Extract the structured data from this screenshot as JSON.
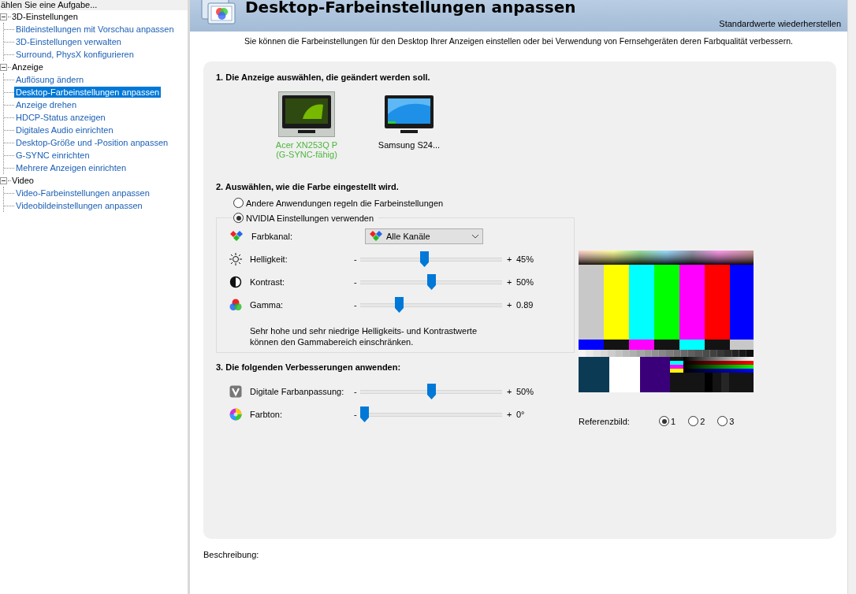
{
  "sidebar": {
    "header": "ählen Sie eine Aufgabe...",
    "tree": [
      {
        "label": "3D-Einstellungen",
        "expanded": true,
        "children": [
          {
            "label": "Bildeinstellungen mit Vorschau anpassen",
            "selected": false
          },
          {
            "label": "3D-Einstellungen verwalten",
            "selected": false
          },
          {
            "label": "Surround, PhysX konfigurieren",
            "selected": false
          }
        ]
      },
      {
        "label": "Anzeige",
        "expanded": true,
        "children": [
          {
            "label": "Auflösung ändern",
            "selected": false
          },
          {
            "label": "Desktop-Farbeinstellungen anpassen",
            "selected": true
          },
          {
            "label": "Anzeige drehen",
            "selected": false
          },
          {
            "label": "HDCP-Status anzeigen",
            "selected": false
          },
          {
            "label": "Digitales Audio einrichten",
            "selected": false
          },
          {
            "label": "Desktop-Größe und -Position anpassen",
            "selected": false
          },
          {
            "label": "G-SYNC einrichten",
            "selected": false
          },
          {
            "label": "Mehrere Anzeigen einrichten",
            "selected": false
          }
        ]
      },
      {
        "label": "Video",
        "expanded": true,
        "children": [
          {
            "label": "Video-Farbeinstellungen anpassen",
            "selected": false
          },
          {
            "label": "Videobildeinstellungen anpassen",
            "selected": false
          }
        ]
      }
    ]
  },
  "page": {
    "title": "Desktop-Farbeinstellungen anpassen",
    "restore_link": "Standardwerte wiederherstellen",
    "intro": "Sie können die Farbeinstellungen für den Desktop Ihrer Anzeigen einstellen oder bei Verwendung von Fernsehgeräten deren Farbqualität verbessern."
  },
  "section1": {
    "heading": "1. Die Anzeige auswählen, die geändert werden soll.",
    "displays": [
      {
        "kind": "nvidia",
        "label": "Acer XN253Q P\n(G-SYNC-fähig)",
        "selected": true
      },
      {
        "kind": "desktop",
        "label": "Samsung S24...",
        "selected": false
      }
    ]
  },
  "section2": {
    "heading": "2. Auswählen, wie die Farbe eingestellt wird.",
    "modes": [
      {
        "label": "Andere Anwendungen regeln die Farbeinstellungen",
        "selected": false
      },
      {
        "label": "NVIDIA Einstellungen verwenden",
        "selected": true
      }
    ],
    "channel": {
      "label": "Farbkanal:",
      "value": "Alle Kanäle"
    },
    "sliders": [
      {
        "kind": "brightness",
        "label": "Helligkeit:",
        "minus": "-",
        "plus": "+",
        "level": 0.45,
        "reading": "45%"
      },
      {
        "kind": "contrast",
        "label": "Kontrast:",
        "minus": "-",
        "plus": "+",
        "level": 0.5,
        "reading": "50%"
      },
      {
        "kind": "gamma",
        "label": "Gamma:",
        "minus": "-",
        "plus": "+",
        "level": 0.26,
        "reading": "0.89"
      }
    ],
    "note": "Sehr hohe und sehr niedrige Helligkeits- und Kontrastwerte\nkönnen den Gammabereich einschränken."
  },
  "section3": {
    "heading": "3. Die folgenden Verbesserungen anwenden:",
    "sliders": [
      {
        "kind": "vibrance",
        "label": "Digitale Farbanpassung:",
        "minus": "-",
        "plus": "+",
        "level": 0.5,
        "reading": "50%"
      },
      {
        "kind": "hue",
        "label": "Farbton:",
        "minus": "-",
        "plus": "+",
        "level": 0.0,
        "reading": "0°"
      }
    ]
  },
  "reference": {
    "label": "Referenzbild:",
    "options": [
      {
        "label": "1",
        "selected": true
      },
      {
        "label": "2",
        "selected": false
      },
      {
        "label": "3",
        "selected": false
      }
    ]
  },
  "description_label": "Beschreibung:"
}
